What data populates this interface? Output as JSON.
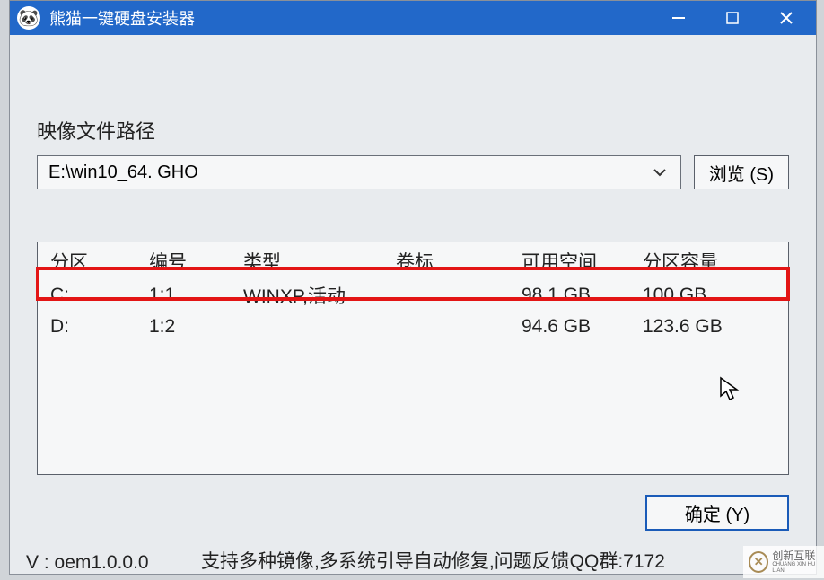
{
  "titlebar": {
    "icon_emoji": "🐼",
    "title": "熊猫一键硬盘安装器"
  },
  "win_controls": {
    "minimize": "–",
    "maximize": "□",
    "close": "×"
  },
  "labels": {
    "image_path": "映像文件路径",
    "browse": "浏览 (S)",
    "ok": "确定 (Y)"
  },
  "combo": {
    "value": "E:\\win10_64. GHO"
  },
  "grid": {
    "headers": {
      "partition": "分区",
      "number": "编号",
      "type": "类型",
      "volume": "卷标",
      "free": "可用空间",
      "capacity": "分区容量"
    },
    "rows": [
      {
        "partition": "C:",
        "number": "1:1",
        "type": "WINXP,活动",
        "volume": "",
        "free": "98.1 GB",
        "capacity": "100 GB"
      },
      {
        "partition": "D:",
        "number": "1:2",
        "type": "",
        "volume": "",
        "free": "94.6 GB",
        "capacity": "123.6 GB"
      }
    ]
  },
  "footer": {
    "version": "V : oem1.0.0.0",
    "info": "支持多种镜像,多系统引导自动修复,问题反馈QQ群:7172"
  },
  "watermark": {
    "cn": "创新互联",
    "en": "CHUANG XIN HU LIAN"
  }
}
